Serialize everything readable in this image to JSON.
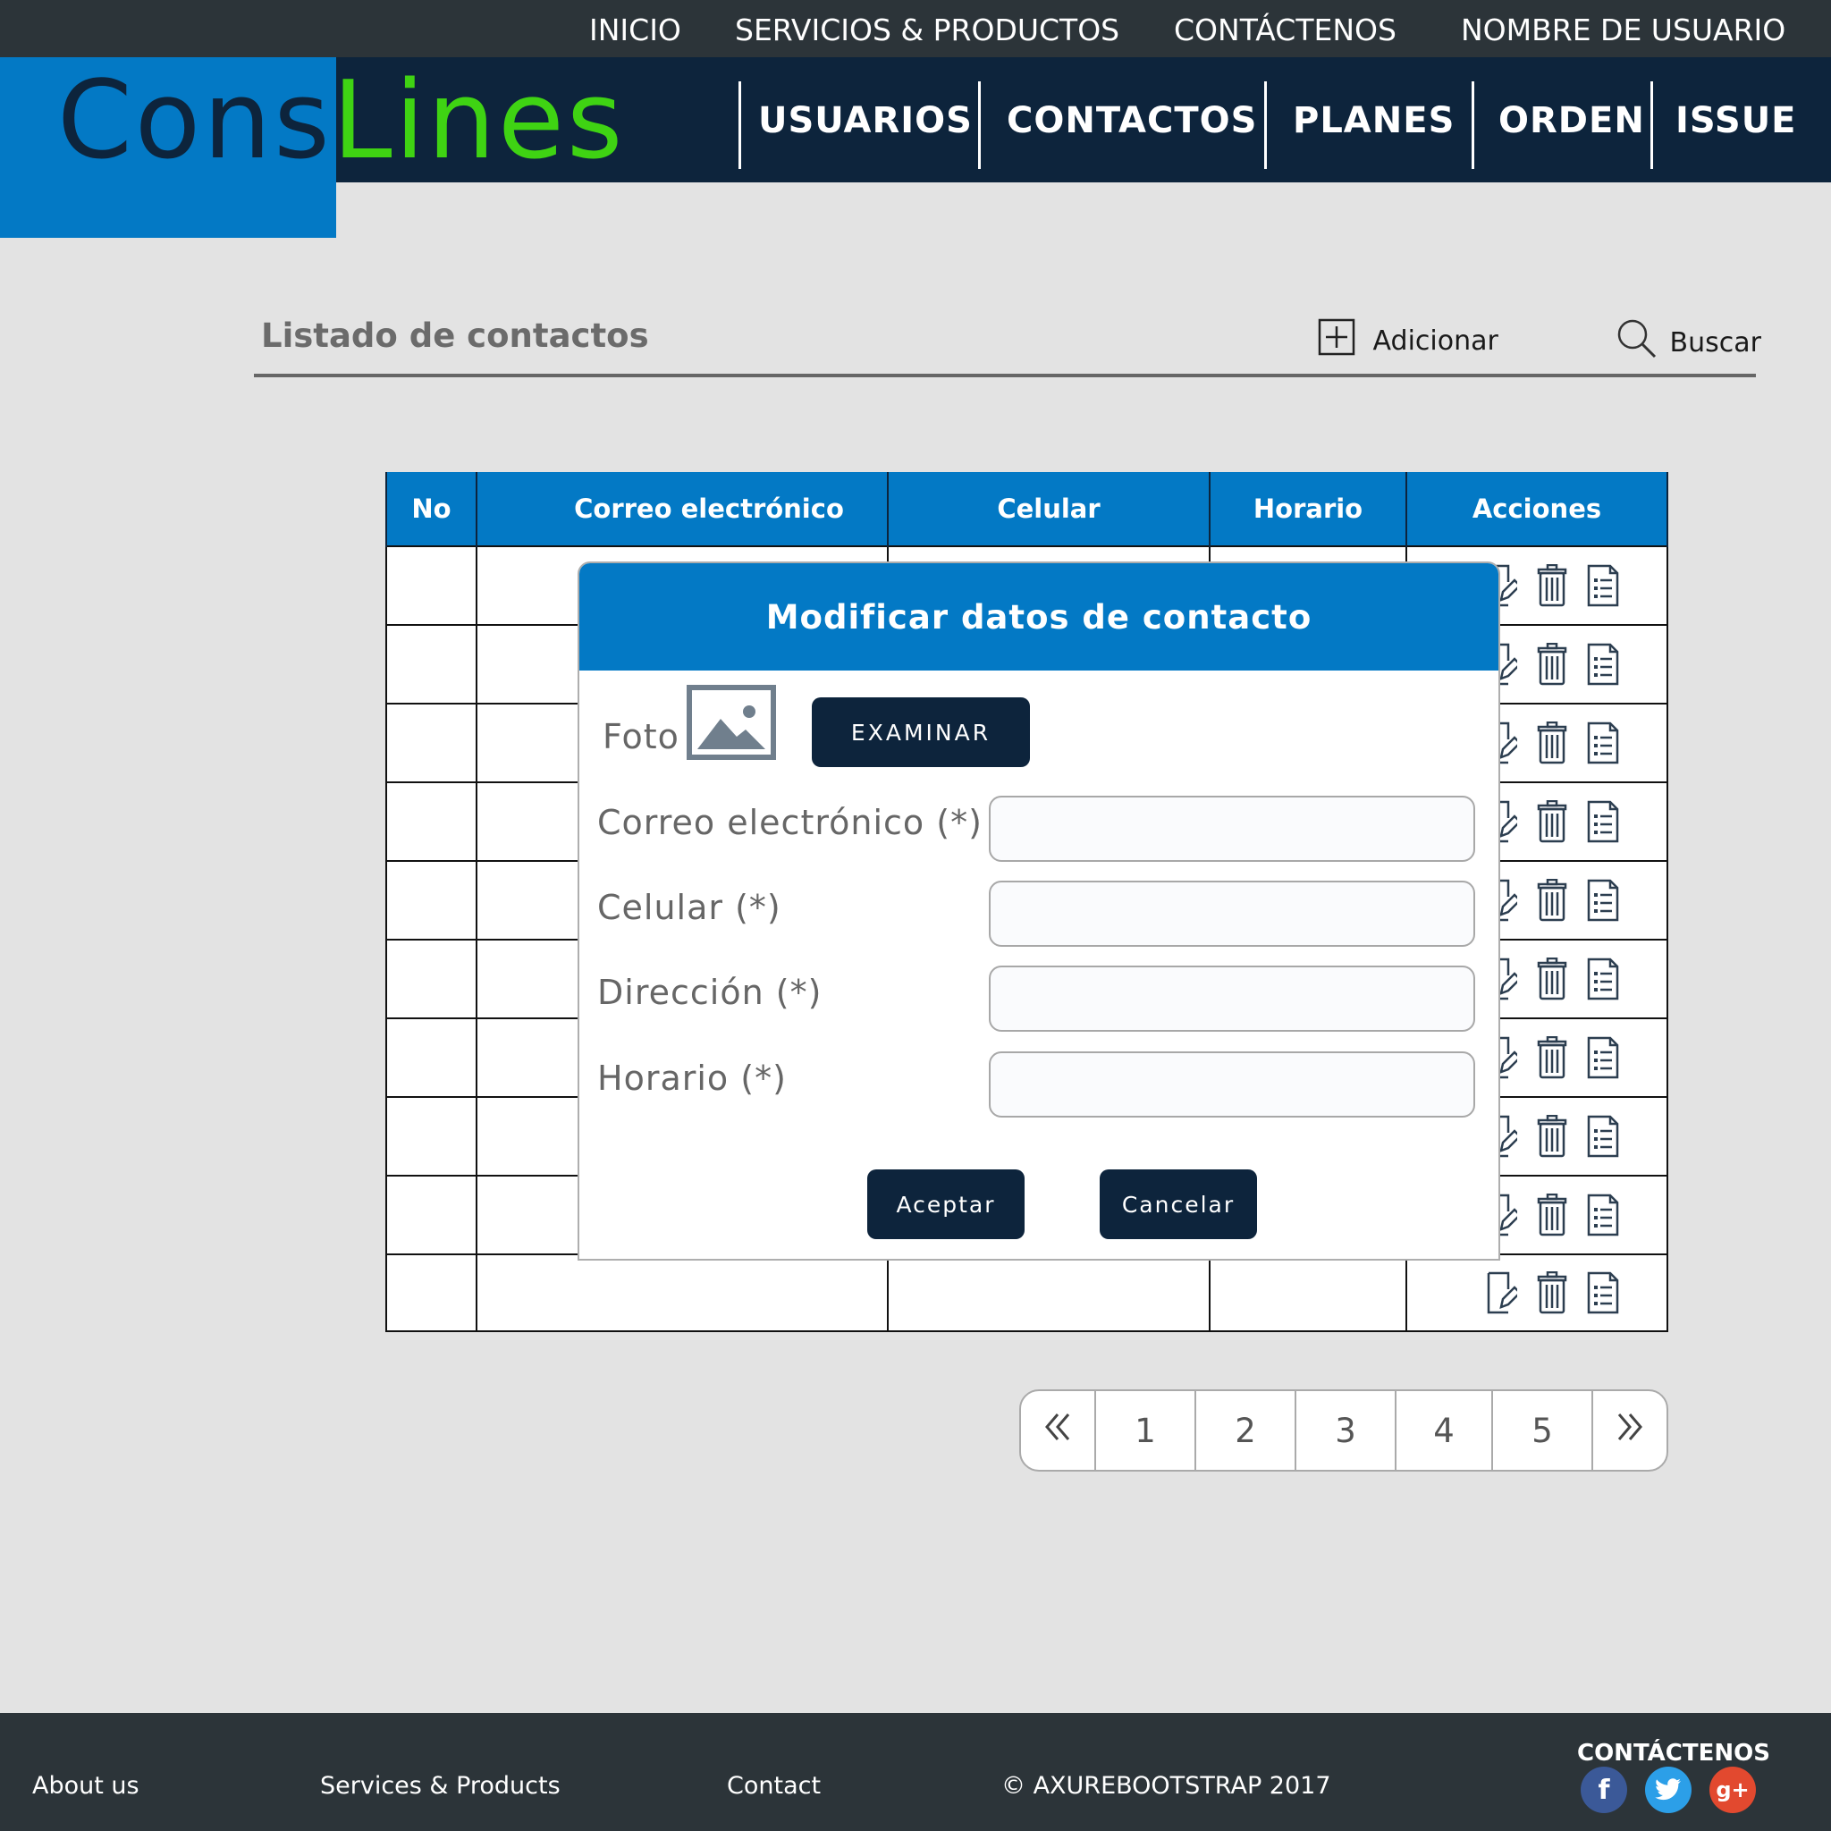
{
  "topbar": {
    "links": [
      "INICIO",
      "SERVICIOS & PRODUCTOS",
      "CONTÁCTENOS",
      "NOMBRE DE USUARIO"
    ]
  },
  "logo": {
    "part1": "Cons",
    "part2": "Lines"
  },
  "nav": {
    "items": [
      "USUARIOS",
      "CONTACTOS",
      "PLANES",
      "ORDEN",
      "ISSUE"
    ]
  },
  "list": {
    "title": "Listado de contactos",
    "add_label": "Adicionar",
    "search_label": "Buscar"
  },
  "table": {
    "headers": [
      "No",
      "Correo electrónico",
      "Celular",
      "Horario",
      "Acciones"
    ],
    "row_count": 10,
    "action_icons": [
      "edit-icon",
      "trash-icon",
      "details-list-icon"
    ]
  },
  "pagination": {
    "prev_icon": "double-chevron-left-icon",
    "pages": [
      "1",
      "2",
      "3",
      "4",
      "5"
    ],
    "next_icon": "double-chevron-right-icon"
  },
  "modal": {
    "title": "Modificar datos de contacto",
    "photo_label": "Foto",
    "browse_label": "EXAMINAR",
    "fields": [
      {
        "label": "Correo electrónico (*)",
        "value": ""
      },
      {
        "label": "Celular (*)",
        "value": ""
      },
      {
        "label": "Dirección (*)",
        "value": ""
      },
      {
        "label": "Horario (*)",
        "value": ""
      }
    ],
    "accept_label": "Aceptar",
    "cancel_label": "Cancelar"
  },
  "footer": {
    "links": [
      "About us",
      "Services & Products",
      "Contact"
    ],
    "copyright": "© AXUREBOOTSTRAP 2017",
    "contact_heading": "CONTÁCTENOS",
    "social": [
      {
        "icon": "facebook-icon",
        "glyph": "f",
        "color": "#3b5998"
      },
      {
        "icon": "twitter-icon",
        "glyph": "t",
        "color": "#2c9fe8"
      },
      {
        "icon": "google-plus-icon",
        "glyph": "g+",
        "color": "#e2492f"
      }
    ]
  },
  "colors": {
    "brand_blue": "#0379c5",
    "navy": "#0d243c",
    "green": "#3fd313",
    "dark_bar": "#2c3439"
  }
}
